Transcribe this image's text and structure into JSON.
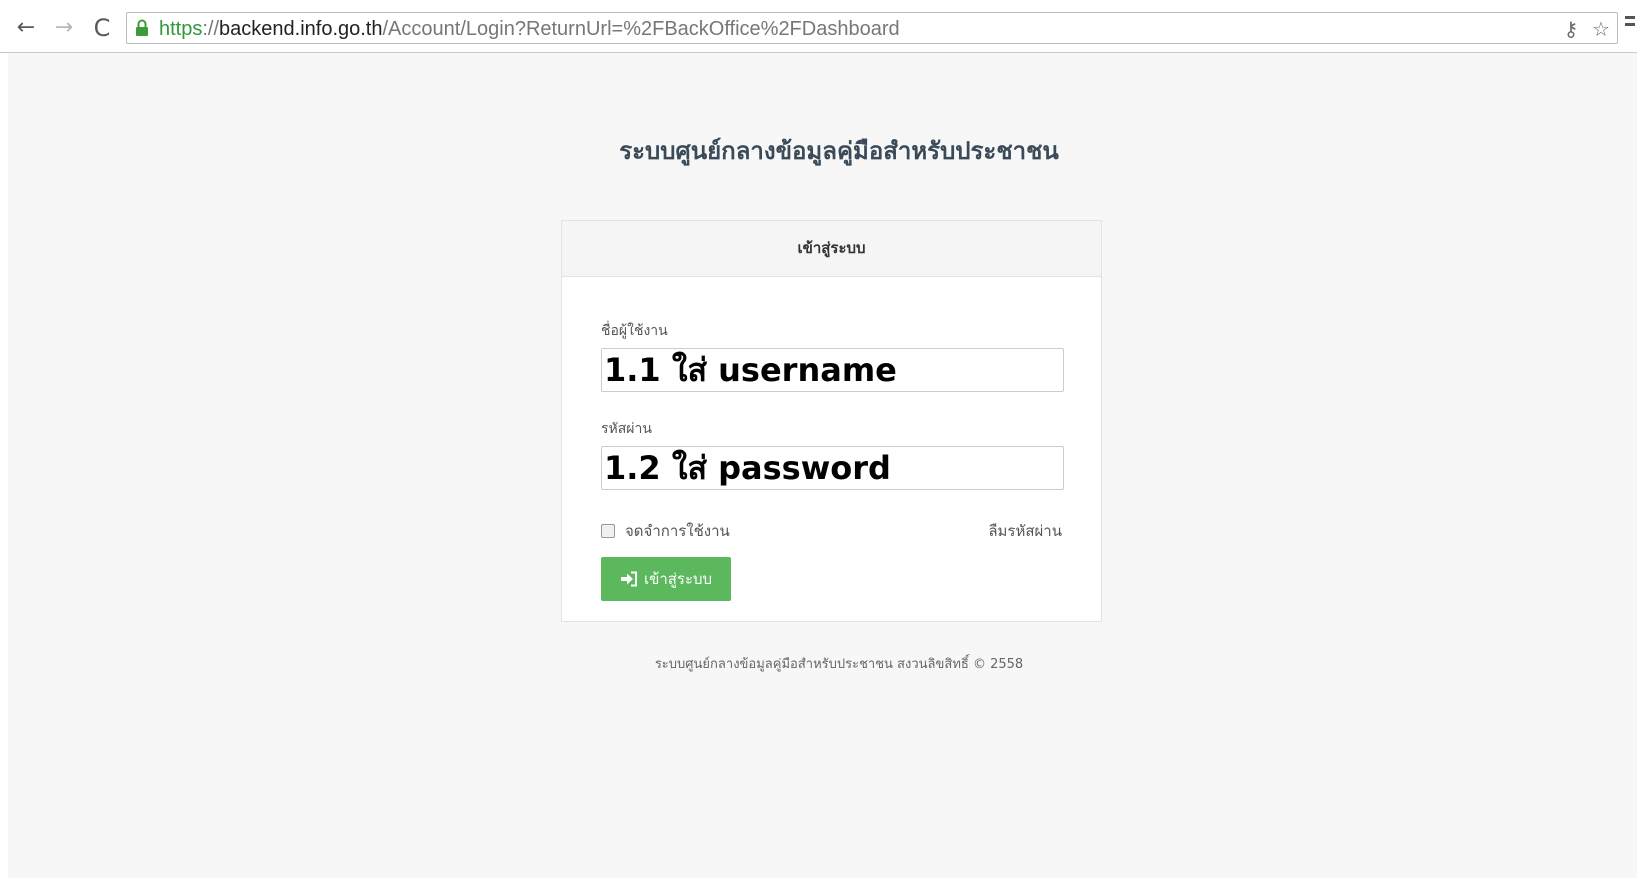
{
  "browser": {
    "url_scheme": "https",
    "url_sep": "://",
    "url_host": "backend.info.go.th",
    "url_path": "/Account/Login?ReturnUrl=%2FBackOffice%2FDashboard",
    "back_glyph": "←",
    "forward_glyph": "→",
    "reload_glyph": "C",
    "key_glyph": "⚷",
    "star_glyph": "☆",
    "icons": [
      "back-arrow-icon",
      "forward-arrow-icon",
      "reload-icon",
      "lock-icon",
      "key-icon",
      "star-icon",
      "menu-icon"
    ]
  },
  "page": {
    "title": "ระบบศูนย์กลางข้อมูลคู่มือสำหรับประชาชน",
    "footer": "ระบบศูนย์กลางข้อมูลคู่มือสำหรับประชาชน สงวนลิขสิทธิ์ © 2558"
  },
  "login": {
    "heading": "เข้าสู่ระบบ",
    "username_label": "ชื่อผู้ใช้งาน",
    "username_value": "1.1 ใส่ username",
    "password_label": "รหัสผ่าน",
    "password_value": "1.2 ใส่ password",
    "remember_label": "จดจำการใช้งาน",
    "remember_checked": false,
    "forgot_label": "ลืมรหัสผ่าน",
    "submit_label": "เข้าสู่ระบบ",
    "submit_color": "#5cb85c"
  },
  "colors": {
    "secure_green": "#2e9a3a",
    "page_bg": "#f7f7f7",
    "title_color": "#3a4a58"
  }
}
